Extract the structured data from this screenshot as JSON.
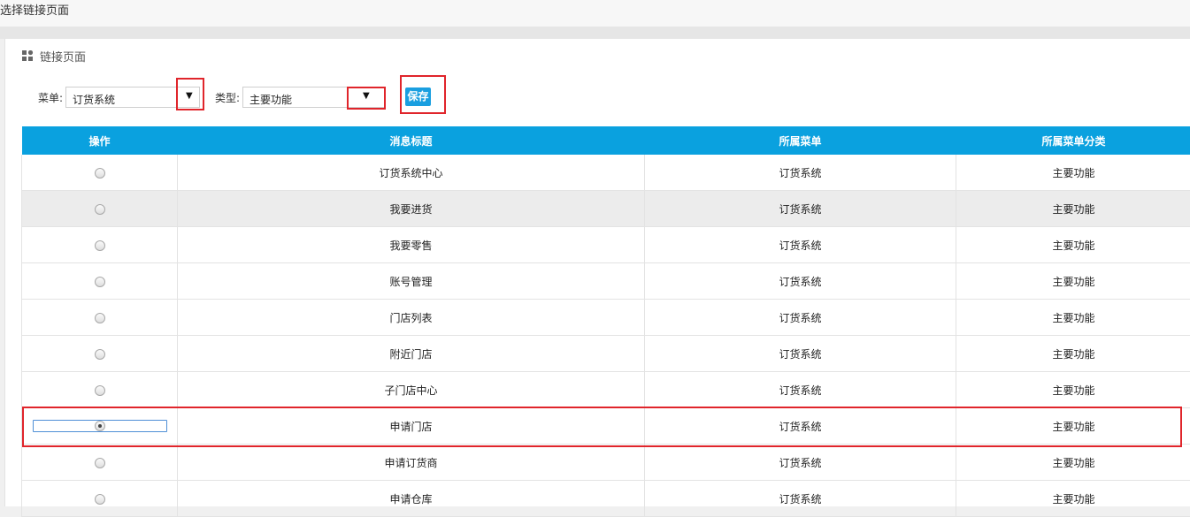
{
  "window": {
    "title": "选择链接页面"
  },
  "panel": {
    "title": "链接页面",
    "icon": "grid-icon"
  },
  "filters": {
    "menu_label": "菜单:",
    "menu_value": "订货系统",
    "type_label": "类型:",
    "type_value": "主要功能",
    "save_label": "保存"
  },
  "table": {
    "headers": [
      "操作",
      "消息标题",
      "所属菜单",
      "所属菜单分类"
    ],
    "rows": [
      {
        "title": "订货系统中心",
        "menu": "订货系统",
        "category": "主要功能"
      },
      {
        "title": "我要进货",
        "menu": "订货系统",
        "category": "主要功能"
      },
      {
        "title": "我要零售",
        "menu": "订货系统",
        "category": "主要功能"
      },
      {
        "title": "账号管理",
        "menu": "订货系统",
        "category": "主要功能"
      },
      {
        "title": "门店列表",
        "menu": "订货系统",
        "category": "主要功能"
      },
      {
        "title": "附近门店",
        "menu": "订货系统",
        "category": "主要功能"
      },
      {
        "title": "子门店中心",
        "menu": "订货系统",
        "category": "主要功能"
      },
      {
        "title": "申请门店",
        "menu": "订货系统",
        "category": "主要功能",
        "selected": true
      },
      {
        "title": "申请订货商",
        "menu": "订货系统",
        "category": "主要功能"
      },
      {
        "title": "申请仓库",
        "menu": "订货系统",
        "category": "主要功能"
      }
    ]
  },
  "colors": {
    "header_bg": "#0aa1df",
    "highlight": "#e0252b",
    "button": "#1a9fe0"
  }
}
